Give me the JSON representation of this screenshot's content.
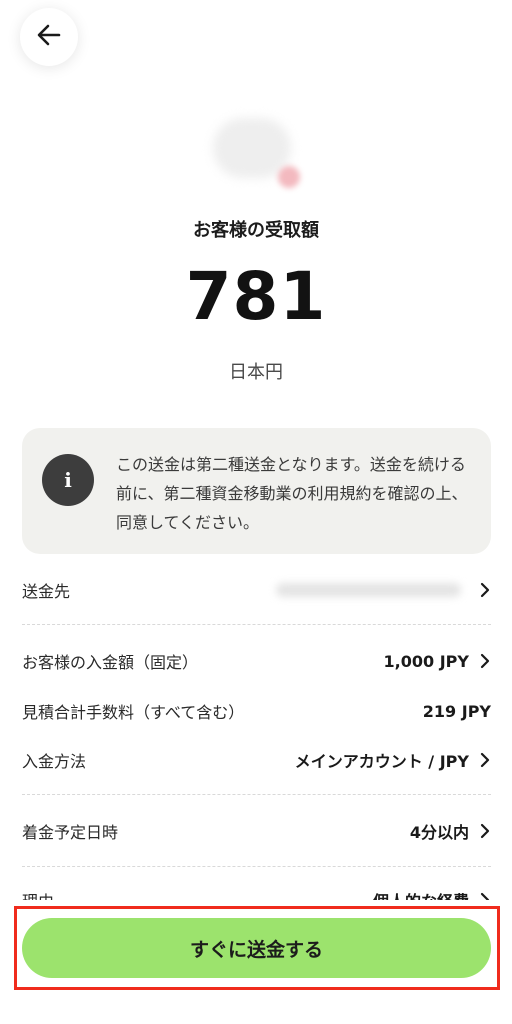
{
  "header": {
    "back_icon": "arrow-left-icon"
  },
  "summary": {
    "receive_label": "お客様の受取額",
    "amount": "781",
    "currency_name": "日本円"
  },
  "notice": {
    "icon_glyph": "i",
    "text": "この送金は第二種送金となります。送金を続ける前に、第二種資金移動業の利用規約を確認の上、同意してください。"
  },
  "details": {
    "recipient": {
      "label": "送金先"
    },
    "deposit_amount": {
      "label": "お客様の入金額（固定）",
      "value": "1,000 JPY"
    },
    "fee": {
      "label": "見積合計手数料（すべて含む）",
      "value": "219 JPY"
    },
    "payment_method": {
      "label": "入金方法",
      "value": "メインアカウント / JPY"
    },
    "arrival": {
      "label": "着金予定日時",
      "value": "4分以内"
    },
    "reason": {
      "label": "理由",
      "value": "個人的な経費"
    }
  },
  "cta": {
    "label": "すぐに送金する"
  },
  "colors": {
    "cta_green": "#9ce36d",
    "highlight_red": "#f02b1d",
    "info_bg": "#f1f1ee",
    "info_icon_bg": "#3d3d3d"
  }
}
